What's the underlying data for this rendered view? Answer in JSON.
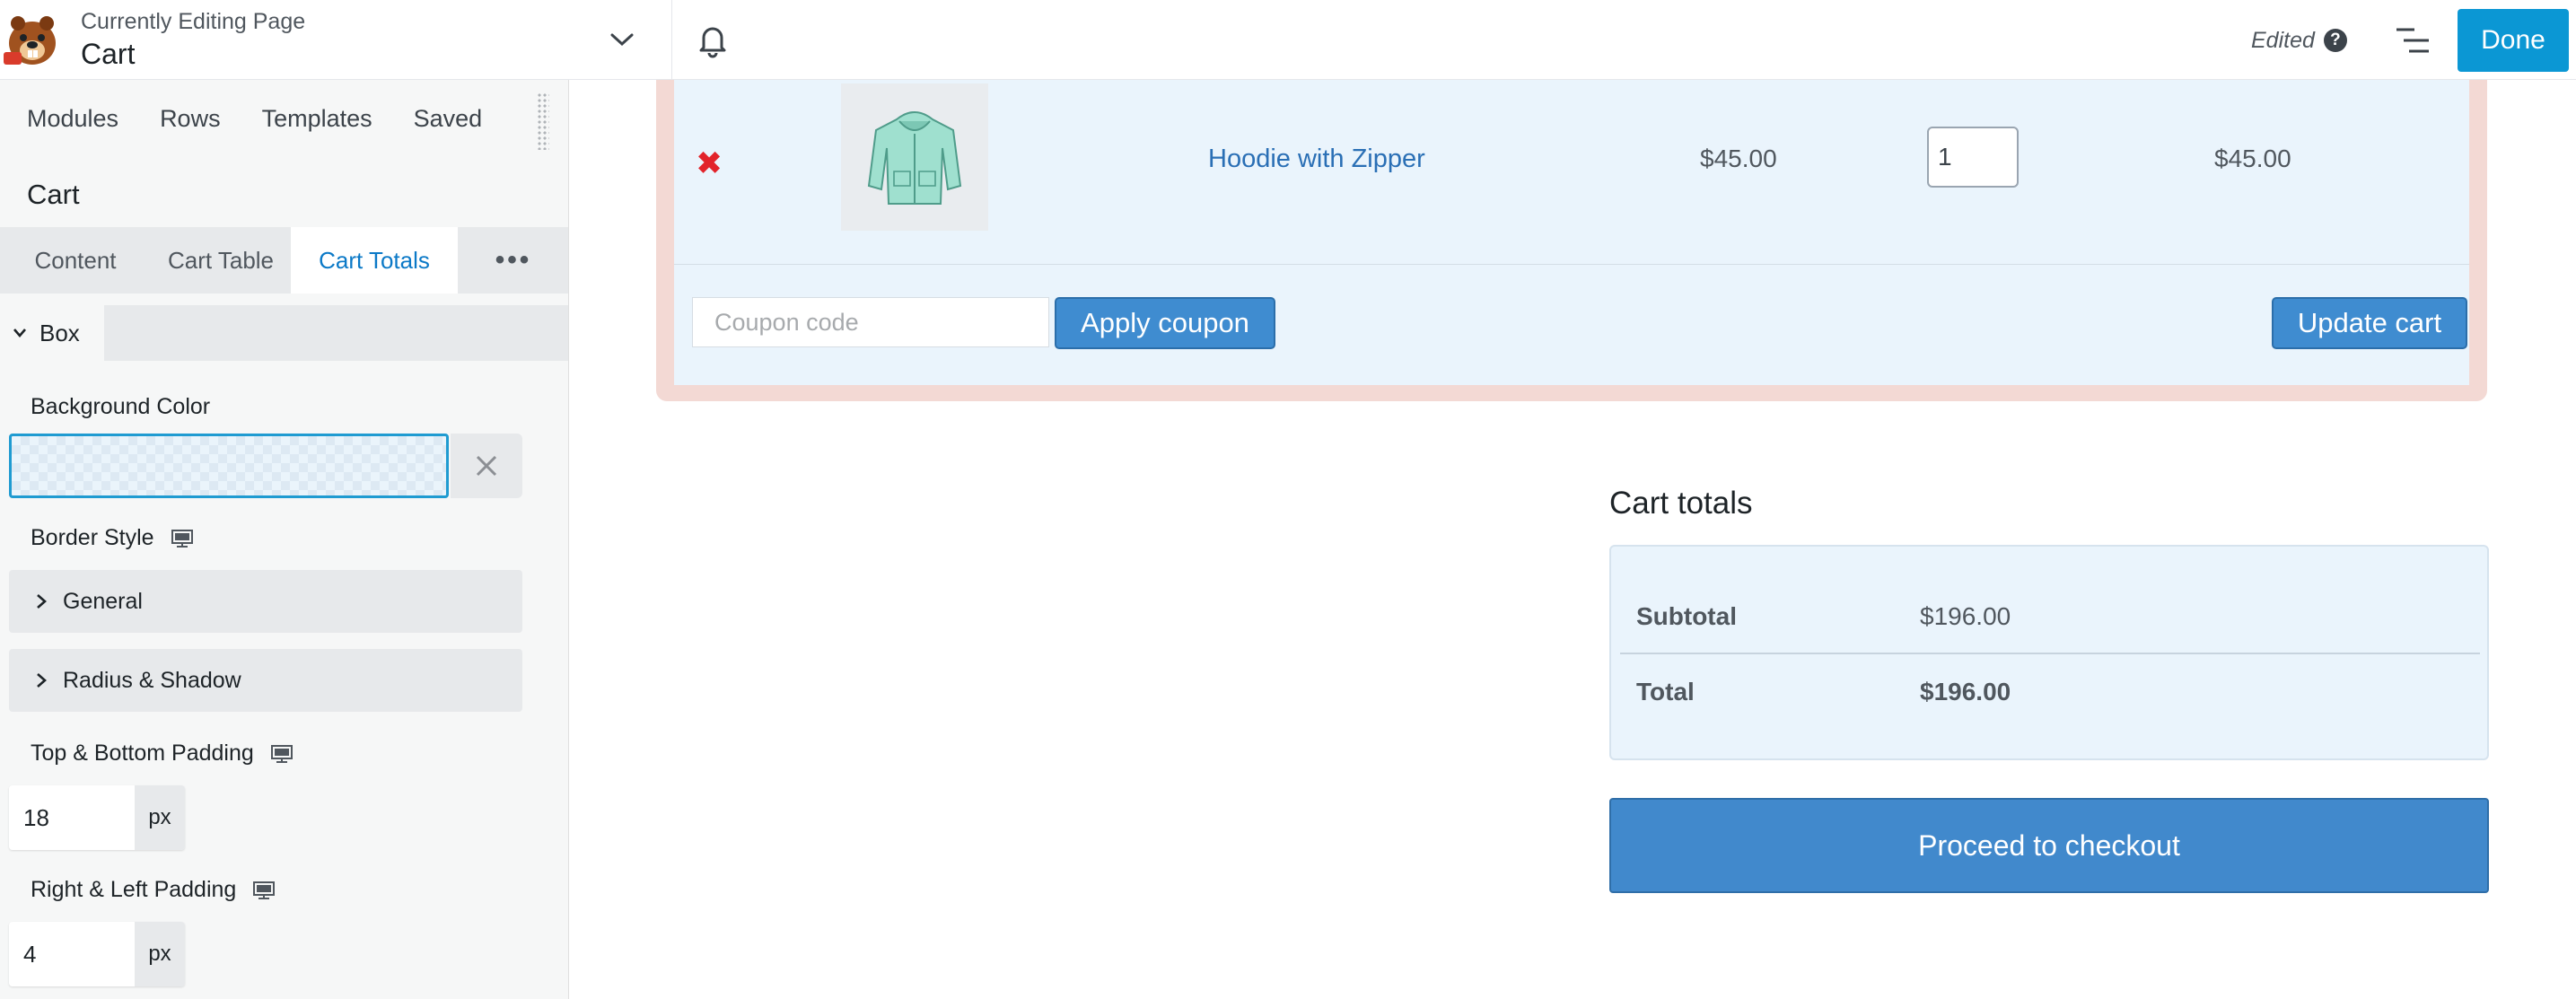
{
  "header": {
    "editing_label": "Currently Editing Page",
    "page_name": "Cart",
    "status": "Edited",
    "done_label": "Done",
    "accent_color": "#0b97d4"
  },
  "sidebar": {
    "main_tabs": [
      "Modules",
      "Rows",
      "Templates",
      "Saved"
    ],
    "module_title": "Cart",
    "settings_tabs": [
      "Content",
      "Cart Table",
      "Cart Totals"
    ],
    "active_settings_tab": "Cart Totals",
    "section_title": "Box",
    "background_color_label": "Background Color",
    "border_style_label": "Border Style",
    "border_groups": [
      "General",
      "Radius & Shadow"
    ],
    "top_bottom_padding_label": "Top & Bottom Padding",
    "top_bottom_padding_value": "18",
    "right_left_padding_label": "Right & Left Padding",
    "right_left_padding_value": "4",
    "unit": "px"
  },
  "cart": {
    "item": {
      "name": "Hoodie with Zipper",
      "price": "$45.00",
      "quantity": "1",
      "subtotal": "$45.00"
    },
    "coupon_placeholder": "Coupon code",
    "apply_coupon_label": "Apply coupon",
    "update_cart_label": "Update cart"
  },
  "totals": {
    "heading": "Cart totals",
    "subtotal_label": "Subtotal",
    "subtotal_value": "$196.00",
    "total_label": "Total",
    "total_value": "$196.00",
    "checkout_label": "Proceed to checkout"
  },
  "icons": {
    "logo": "beaver-logo",
    "page_dropdown": "chevron-down-icon",
    "notifications": "bell-icon",
    "help": "question-icon",
    "outline": "outline-list-icon",
    "more": "ellipsis-icon",
    "remove": "remove-x-icon",
    "clear": "close-icon",
    "responsive": "desktop-icon"
  }
}
